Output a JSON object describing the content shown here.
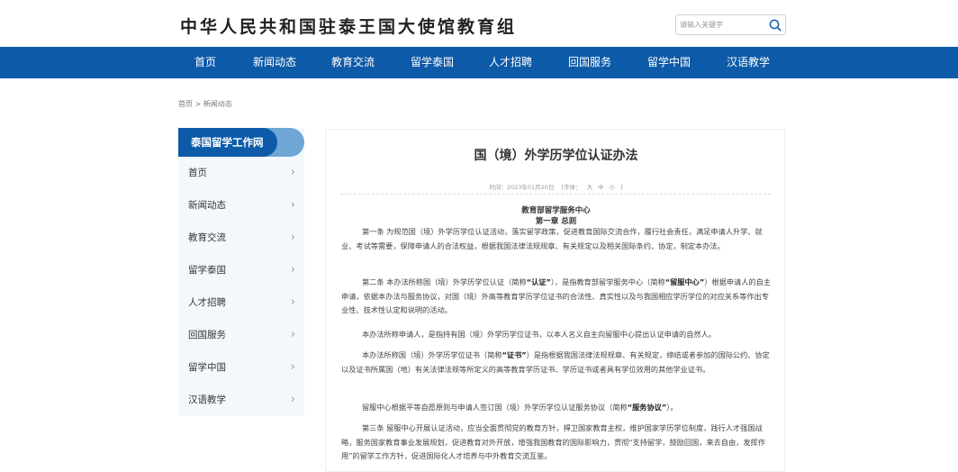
{
  "header": {
    "site_title": "中华人民共和国驻泰王国大使馆教育组",
    "search_placeholder": "请输入关键字"
  },
  "nav": {
    "items": [
      "首页",
      "新闻动态",
      "教育交流",
      "留学泰国",
      "人才招聘",
      "回国服务",
      "留学中国",
      "汉语教学"
    ]
  },
  "breadcrumb": "首页 > 新闻动态",
  "sidebar": {
    "title": "泰国留学工作网",
    "items": [
      "首页",
      "新闻动态",
      "教育交流",
      "留学泰国",
      "人才招聘",
      "回国服务",
      "留学中国",
      "汉语教学"
    ]
  },
  "article": {
    "title": "国（境）外学历学位认证办法",
    "meta_time": "时间：2023年01月20日",
    "meta_font": "[字体：",
    "meta_big": "大",
    "meta_mid": "中",
    "meta_small": "小",
    "meta_end": "]",
    "org": "教育部留学服务中心",
    "chapter": "第一章 总则",
    "p1": "第一条 为规范国（境）外学历学位认证活动，落实留学政策，促进教育国际交流合作，履行社会责任，满足申请人升学、就业、考试等需要，保障申请人的合法权益，根据我国法律法规规章、有关规定以及相关国际条约、协定，制定本办法。",
    "p2a": "第二条 本办法所称国（境）外学历学位认证（简称",
    "p2b": "“认证”",
    "p2c": "），是指教育部留学服务中心（简称",
    "p2d": "“留服中心”",
    "p2e": "）根据申请人的自主申请，依据本办法与服务协议，对国（境）外高等教育学历学位证书的合法性、真实性以及与我国相应学历学位的对应关系等作出专业性、技术性认定和说明的活动。",
    "p3": "本办法所称申请人，是指持有国（境）外学历学位证书，以本人名义自主向留服中心提出认证申请的自然人。",
    "p4a": "本办法所称国（境）外学历学位证书（简称",
    "p4b": "“证书”",
    "p4c": "）是指根据我国法律法规规章、有关规定，缔结或者参加的国际公约、协定以及证书所属国（地）有关法律法规等所定义的高等教育学历证书、学历证书或者具有学位效用的其他学业证书。",
    "p5a": "留服中心根据平等自愿原则与申请人签订国（境）外学历学位认证服务协议（简称",
    "p5b": "“服务协议”",
    "p5c": "）。",
    "p6": "第三条 留服中心开展认证活动，应当全面贯彻党的教育方针，捍卫国家教育主权，维护国家学历学位制度，践行人才强国战略，服务国家教育事业发展规划，促进教育对外开放，增强我国教育的国际影响力，贯彻“支持留学，鼓励回国，来去自由，发挥作用”的留学工作方针，促进国际化人才培养与中外教育交流互鉴。"
  }
}
